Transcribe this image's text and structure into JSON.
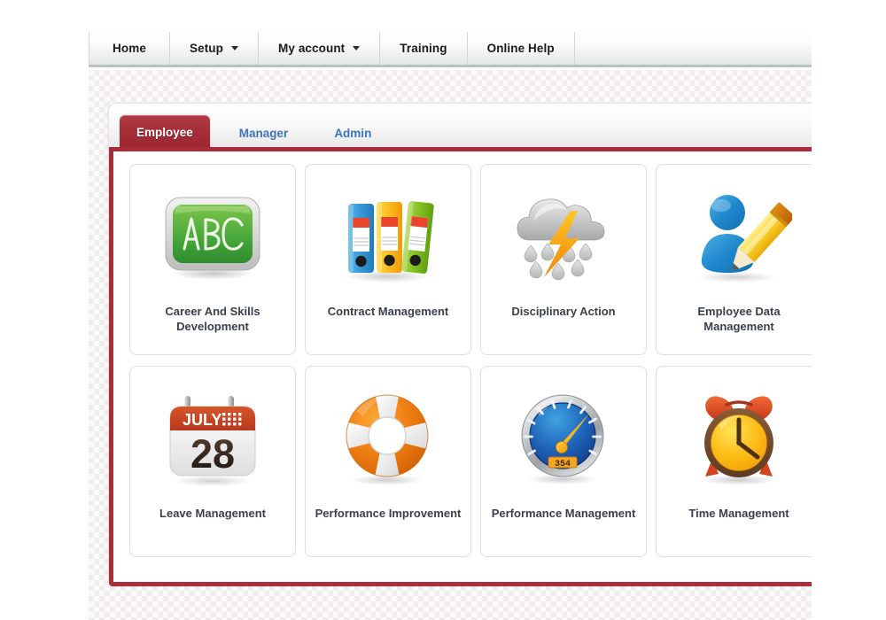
{
  "topnav": {
    "items": [
      {
        "label": "Home",
        "has_caret": false
      },
      {
        "label": "Setup",
        "has_caret": true
      },
      {
        "label": "My account",
        "has_caret": true
      },
      {
        "label": "Training",
        "has_caret": false
      },
      {
        "label": "Online Help",
        "has_caret": false
      }
    ]
  },
  "tabs": [
    {
      "label": "Employee",
      "active": true
    },
    {
      "label": "Manager",
      "active": false
    },
    {
      "label": "Admin",
      "active": false
    }
  ],
  "tiles": [
    {
      "label": "Career And Skills Development",
      "icon": "chalkboard-abc-icon"
    },
    {
      "label": "Contract Management",
      "icon": "binders-icon"
    },
    {
      "label": "Disciplinary Action",
      "icon": "storm-cloud-lightning-icon"
    },
    {
      "label": "Employee Data Management",
      "icon": "person-pencil-icon"
    },
    {
      "label": "Leave Management",
      "icon": "calendar-icon"
    },
    {
      "label": "Performance Improvement",
      "icon": "life-ring-icon"
    },
    {
      "label": "Performance Management",
      "icon": "gauge-icon"
    },
    {
      "label": "Time Management",
      "icon": "alarm-clock-icon"
    }
  ],
  "icon_text": {
    "chalkboard": "ABC",
    "calendar_month": "JULY",
    "calendar_day": "28",
    "gauge_readout": "354"
  },
  "colors": {
    "accent_red": "#ab2c3b",
    "tab_active": "#a52f38",
    "tab_link": "#3f73c4",
    "label_text": "#3b3f4d"
  }
}
